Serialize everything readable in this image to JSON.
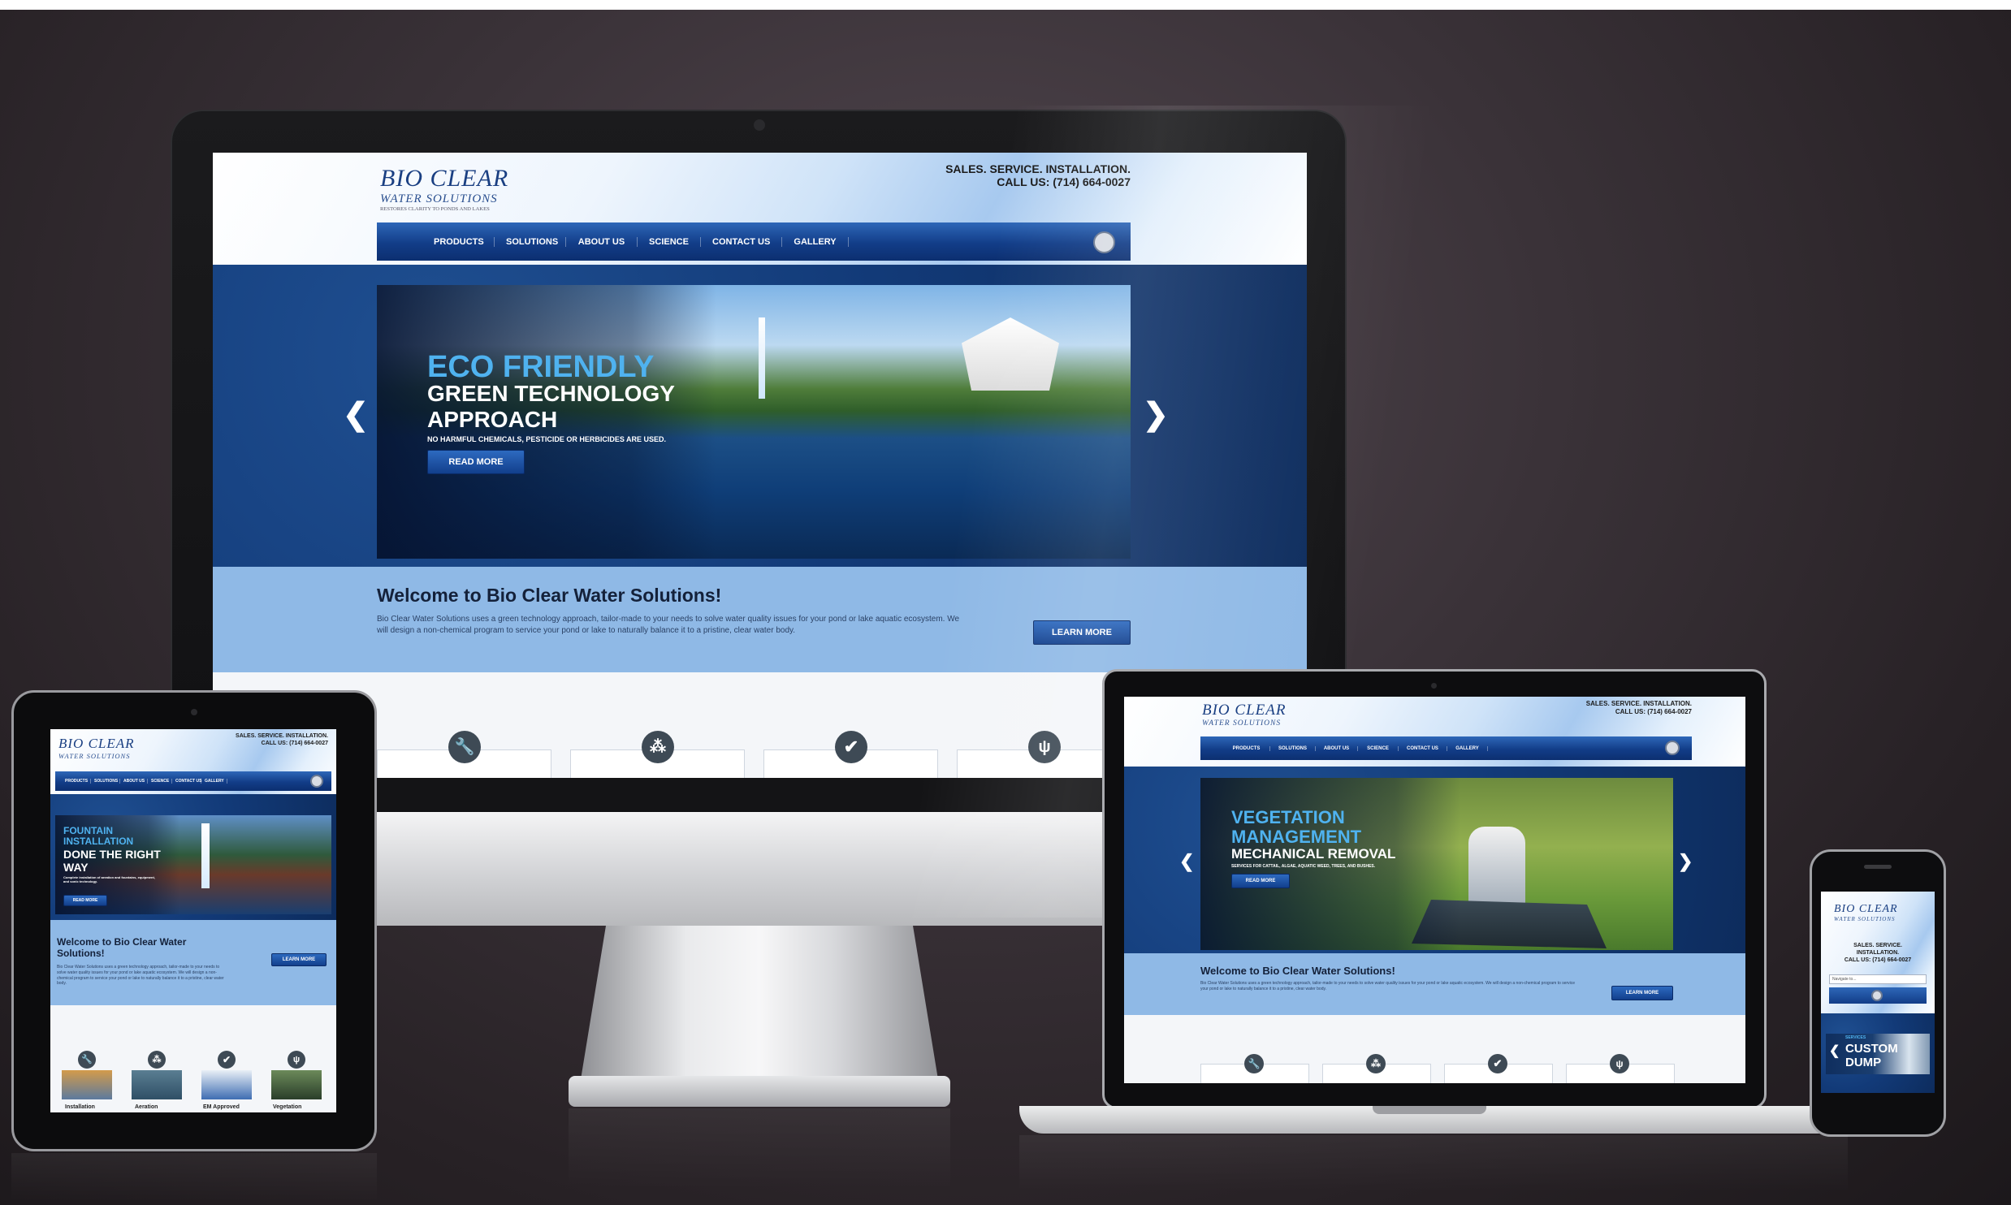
{
  "site": {
    "logo_main": "BIO CLEAR",
    "logo_sub": "WATER SOLUTIONS",
    "logo_tagline": "RESTORES CLARITY TO PONDS AND LAKES",
    "contact_line1": "SALES. SERVICE. INSTALLATION.",
    "contact_line2": "CALL US: (714) 664-0027",
    "nav": [
      "PRODUCTS",
      "SOLUTIONS",
      "ABOUT US",
      "SCIENCE",
      "CONTACT US",
      "GALLERY"
    ],
    "welcome_title": "Welcome to Bio Clear Water Solutions!",
    "welcome_body": "Bio Clear Water Solutions uses a green technology approach, tailor-made to your needs to solve water quality issues for your pond or lake aquatic ecosystem. We will design a non-chemical program to service your pond or lake to naturally balance it to a pristine, clear water body.",
    "learn_more": "LEARN MORE",
    "read_more": "READ MORE",
    "arrow_left": "❮",
    "arrow_right": "❯"
  },
  "desktop_slide": {
    "title_accent": "ECO FRIENDLY",
    "title_line2": "GREEN TECHNOLOGY",
    "title_line3": "APPROACH",
    "caption": "NO HARMFUL CHEMICALS, PESTICIDE OR HERBICIDES ARE USED."
  },
  "laptop_slide": {
    "title_accent1": "VEGETATION",
    "title_accent2": "MANAGEMENT",
    "title_line3": "MECHANICAL REMOVAL",
    "caption": "SERVICES FOR CATTAIL, ALGAE, AQUATIC WEED, TREES, AND BUSHES."
  },
  "tablet_slide": {
    "title_accent1": "FOUNTAIN",
    "title_accent2": "INSTALLATION",
    "title_line3": "DONE THE RIGHT",
    "title_line4": "WAY",
    "caption": "Complete installation of aeration and fountains, equipment, and sonic technology."
  },
  "tablet_cards": [
    "Installation",
    "Aeration",
    "EM Approved",
    "Vegetation"
  ],
  "phone": {
    "contact_lines": [
      "SALES. SERVICE.",
      "INSTALLATION.",
      "CALL US: (714) 664-0027"
    ],
    "navigate_placeholder": "Navigate to...",
    "slide_accent": "SERVICES",
    "slide_title1": "CUSTOM",
    "slide_title2": "DUMP"
  },
  "icons": [
    "wrench-icon",
    "bubbles-icon",
    "checkmark-icon",
    "plant-icon",
    "mail-icon"
  ],
  "colors": {
    "nav_blue": "#123d88",
    "accent_blue": "#4fb2ef",
    "welcome_bg": "#8fb9e6",
    "hero_bg": "#123a78"
  }
}
